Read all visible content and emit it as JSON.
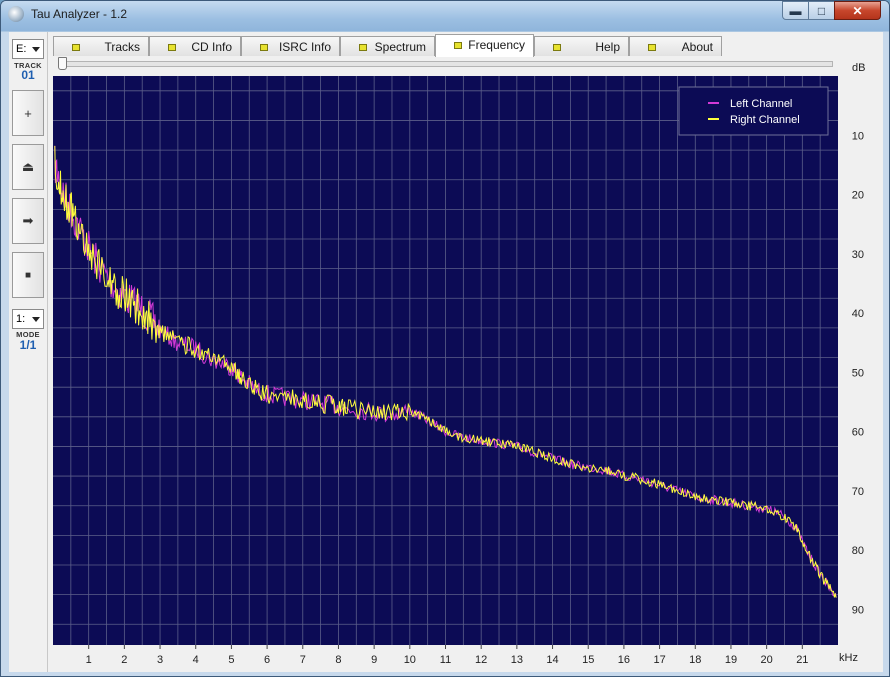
{
  "window": {
    "title": "Tau Analyzer - 1.2",
    "minimize": "▬",
    "maximize": "□",
    "close": "✕"
  },
  "sidebar": {
    "drive_select": "E:",
    "track_label": "TRACK",
    "track_value": "01",
    "buttons": [
      {
        "name": "add-icon",
        "glyph": "+"
      },
      {
        "name": "eject-icon",
        "glyph": "⏏"
      },
      {
        "name": "play-icon",
        "glyph": "➡"
      },
      {
        "name": "stop-icon",
        "glyph": "■"
      }
    ],
    "mode_select": "1:",
    "mode_label": "MODE",
    "mode_value": "1/1"
  },
  "tabs": [
    {
      "label": "Tracks",
      "active": false
    },
    {
      "label": "CD Info",
      "active": false
    },
    {
      "label": "ISRC Info",
      "active": false
    },
    {
      "label": "Spectrum",
      "active": false
    },
    {
      "label": "Frequency",
      "active": true
    },
    {
      "label": "Help",
      "active": false
    },
    {
      "label": "About",
      "active": false
    }
  ],
  "units": {
    "y": "dB",
    "x": "kHz"
  },
  "colors": {
    "plot_bg": "#0c0b55",
    "grid": "#5c5f8a",
    "left": "#d23ad6",
    "right": "#ffff3c"
  },
  "chart_data": {
    "type": "line",
    "xlabel": "kHz",
    "ylabel": "dB",
    "xlim": [
      0,
      22
    ],
    "ylim": [
      0,
      96
    ],
    "y_inverted": true,
    "x_ticks": [
      1,
      2,
      3,
      4,
      5,
      6,
      7,
      8,
      9,
      10,
      11,
      12,
      13,
      14,
      15,
      16,
      17,
      18,
      19,
      20,
      21
    ],
    "y_ticks": [
      10,
      20,
      30,
      40,
      50,
      60,
      70,
      80,
      90
    ],
    "legend_position": "top-right",
    "grid": true,
    "series": [
      {
        "name": "Left Channel",
        "x": [
          0.05,
          0.3,
          0.6,
          1.0,
          1.4,
          1.8,
          2.2,
          2.6,
          3.0,
          3.5,
          4.0,
          4.5,
          5.0,
          5.3,
          5.7,
          6.2,
          6.8,
          7.3,
          7.8,
          8.2,
          8.8,
          9.4,
          10.0,
          10.5,
          11.0,
          11.5,
          12.0,
          12.5,
          13.0,
          13.5,
          14.0,
          14.5,
          15.0,
          15.5,
          16.0,
          16.5,
          17.0,
          17.5,
          18.0,
          18.5,
          19.0,
          19.5,
          20.0,
          20.4,
          20.8,
          21.2,
          21.6,
          21.95
        ],
        "y": [
          15,
          20,
          24,
          29,
          33,
          36,
          38,
          40,
          43,
          45,
          46,
          48,
          49,
          51,
          53,
          54,
          54.5,
          55,
          55.5,
          56,
          56.5,
          57,
          56.5,
          58,
          60,
          61,
          61.5,
          62,
          62.5,
          63.5,
          64.5,
          65.5,
          66,
          66.5,
          67.5,
          68,
          69,
          70,
          71,
          71.5,
          72,
          72.5,
          73,
          74,
          76,
          81,
          85,
          88
        ]
      },
      {
        "name": "Right Channel",
        "x": [
          0.05,
          0.3,
          0.6,
          1.0,
          1.4,
          1.8,
          2.2,
          2.6,
          3.0,
          3.5,
          4.0,
          4.5,
          5.0,
          5.3,
          5.7,
          6.2,
          6.8,
          7.3,
          7.8,
          8.2,
          8.8,
          9.4,
          10.0,
          10.5,
          11.0,
          11.5,
          12.0,
          12.5,
          13.0,
          13.5,
          14.0,
          14.5,
          15.0,
          15.5,
          16.0,
          16.5,
          17.0,
          17.5,
          18.0,
          18.5,
          19.0,
          19.5,
          20.0,
          20.4,
          20.8,
          21.2,
          21.6,
          21.95
        ],
        "y": [
          15,
          20,
          24,
          29,
          33,
          36,
          38,
          40,
          43,
          45,
          46,
          48,
          49,
          51,
          53,
          54,
          54.5,
          55,
          55.5,
          56,
          56.5,
          57,
          56.5,
          58,
          60,
          61,
          61.5,
          62,
          62.5,
          63.5,
          64.5,
          65.5,
          66,
          66.5,
          67.5,
          68,
          69,
          70,
          71,
          71.5,
          72,
          72.5,
          73,
          74,
          76,
          81,
          85,
          88
        ]
      }
    ]
  }
}
